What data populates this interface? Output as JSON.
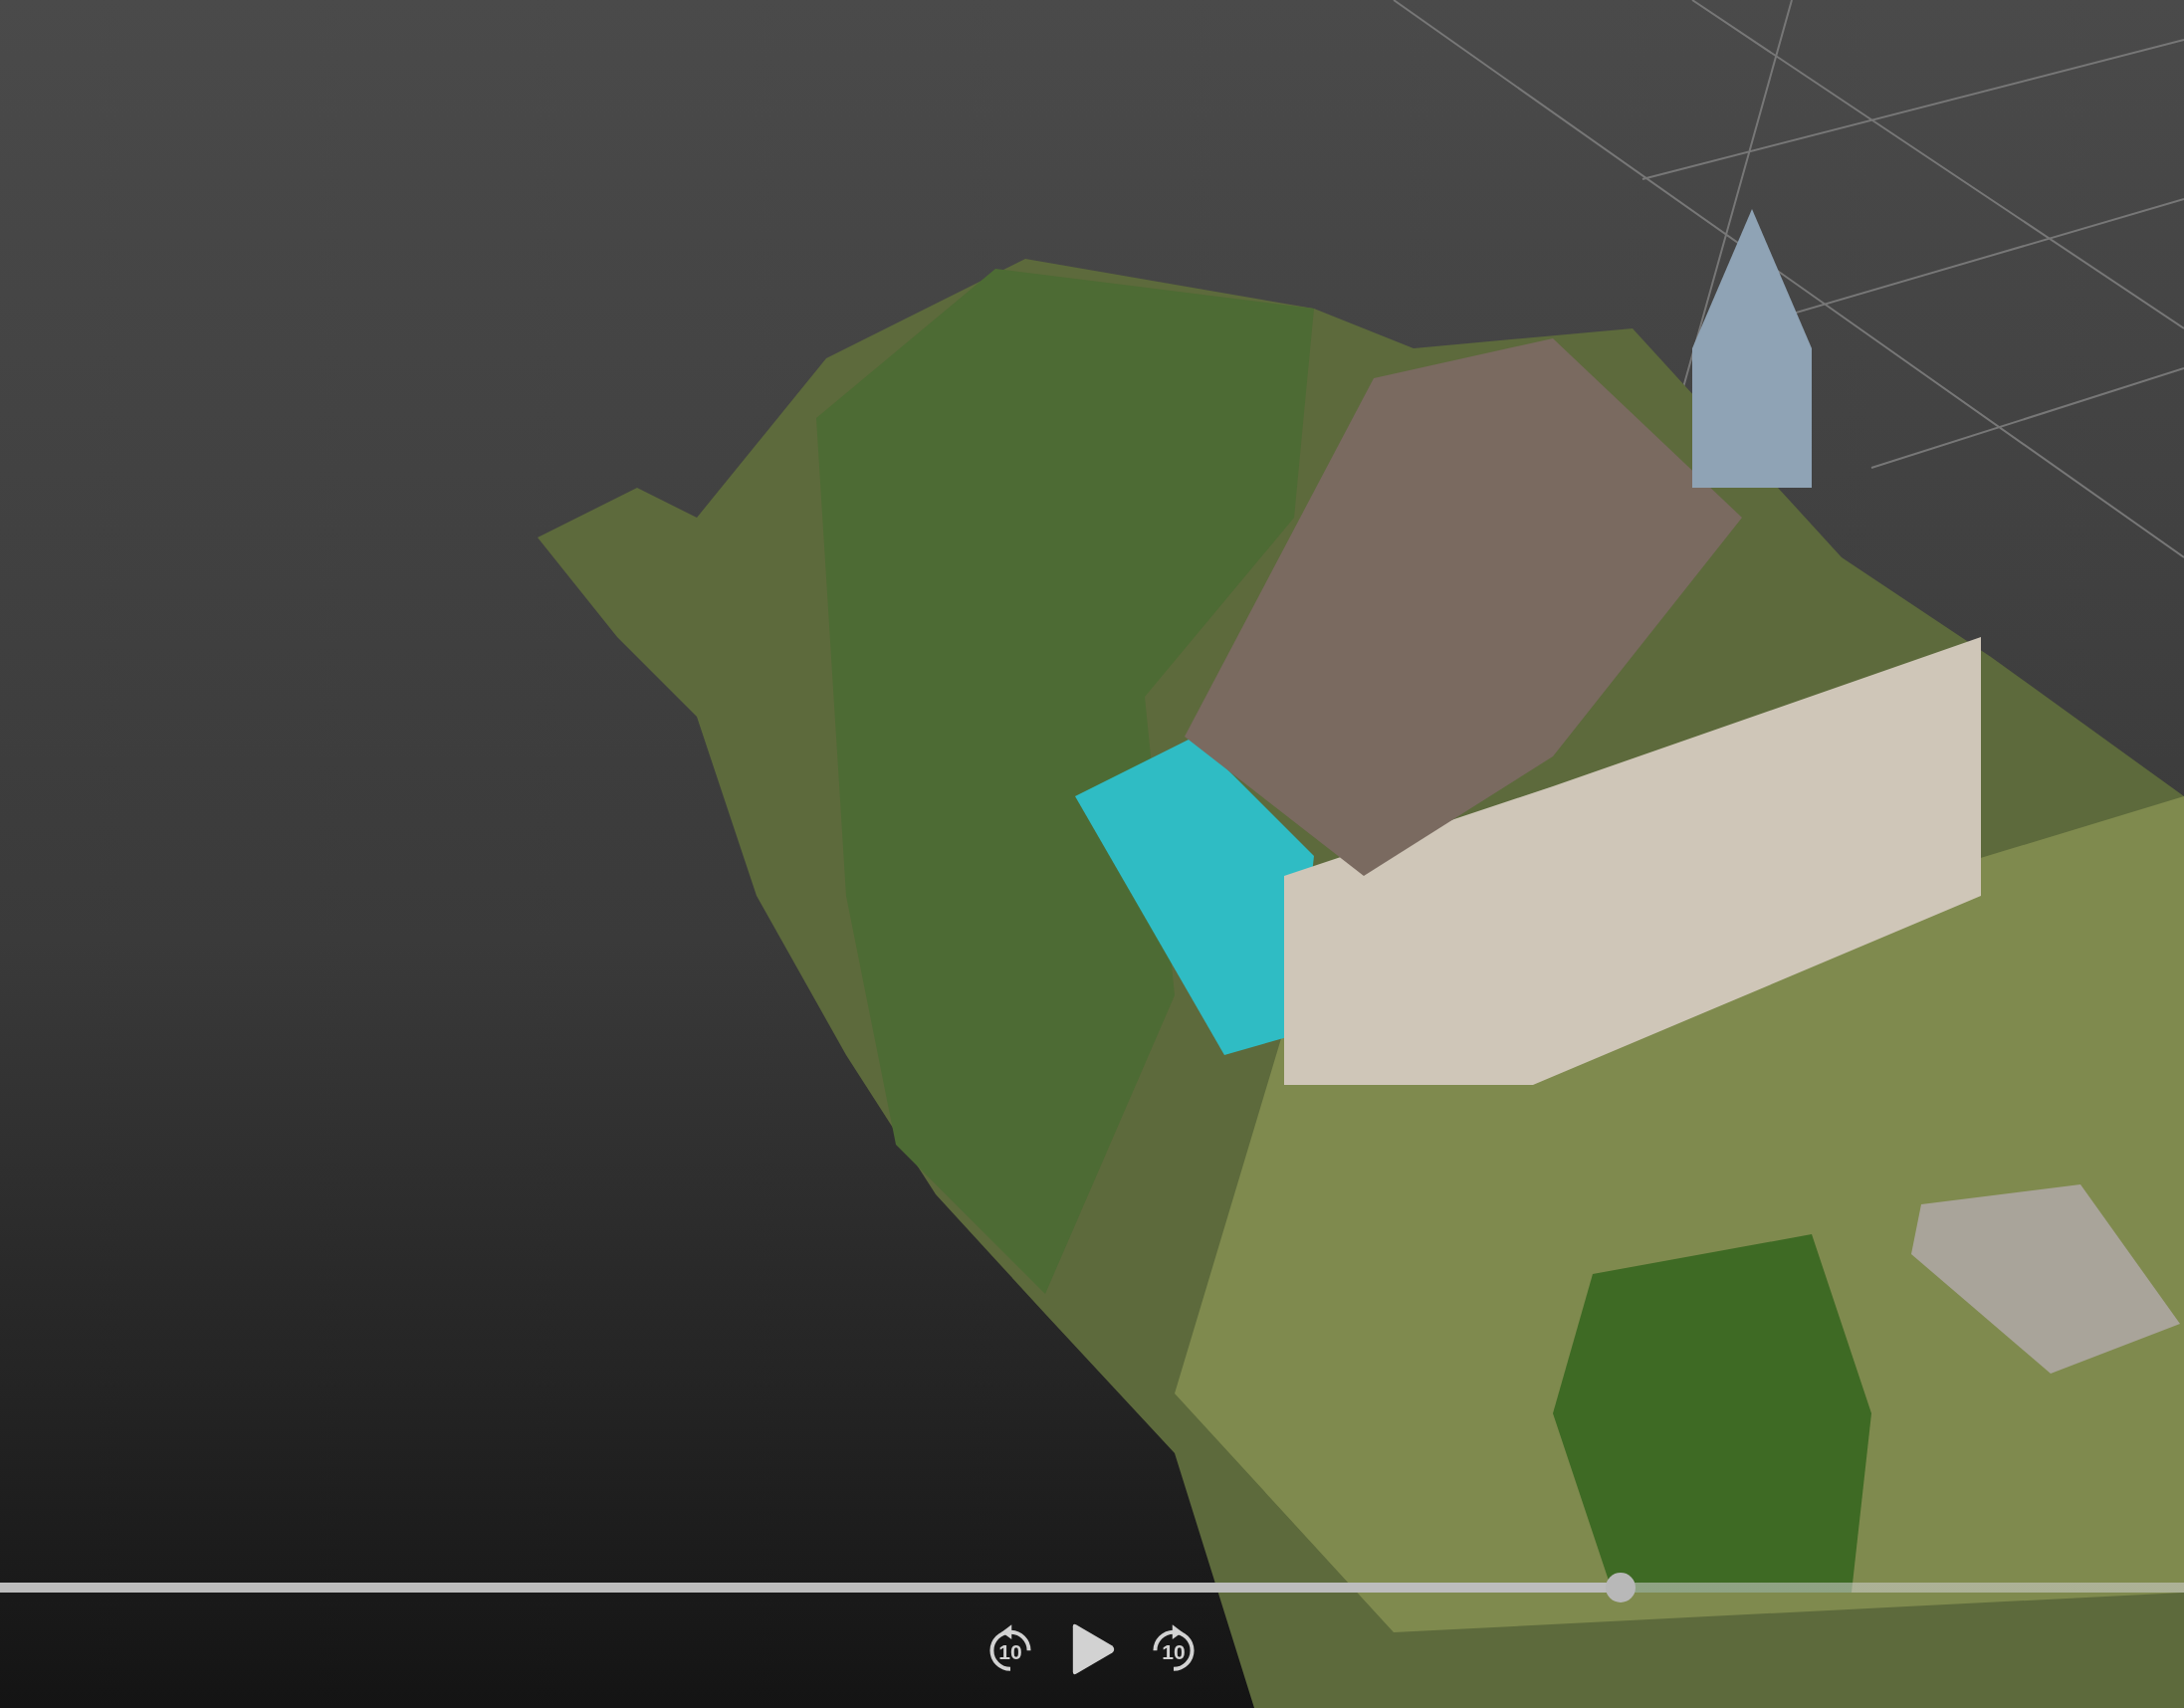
{
  "player": {
    "playing": false,
    "progress": {
      "level": 0.742
    },
    "controls": [
      {
        "kind": "skip_back",
        "label": "10"
      },
      {
        "kind": "play"
      },
      {
        "kind": "skip_forward",
        "label": "10"
      }
    ]
  }
}
